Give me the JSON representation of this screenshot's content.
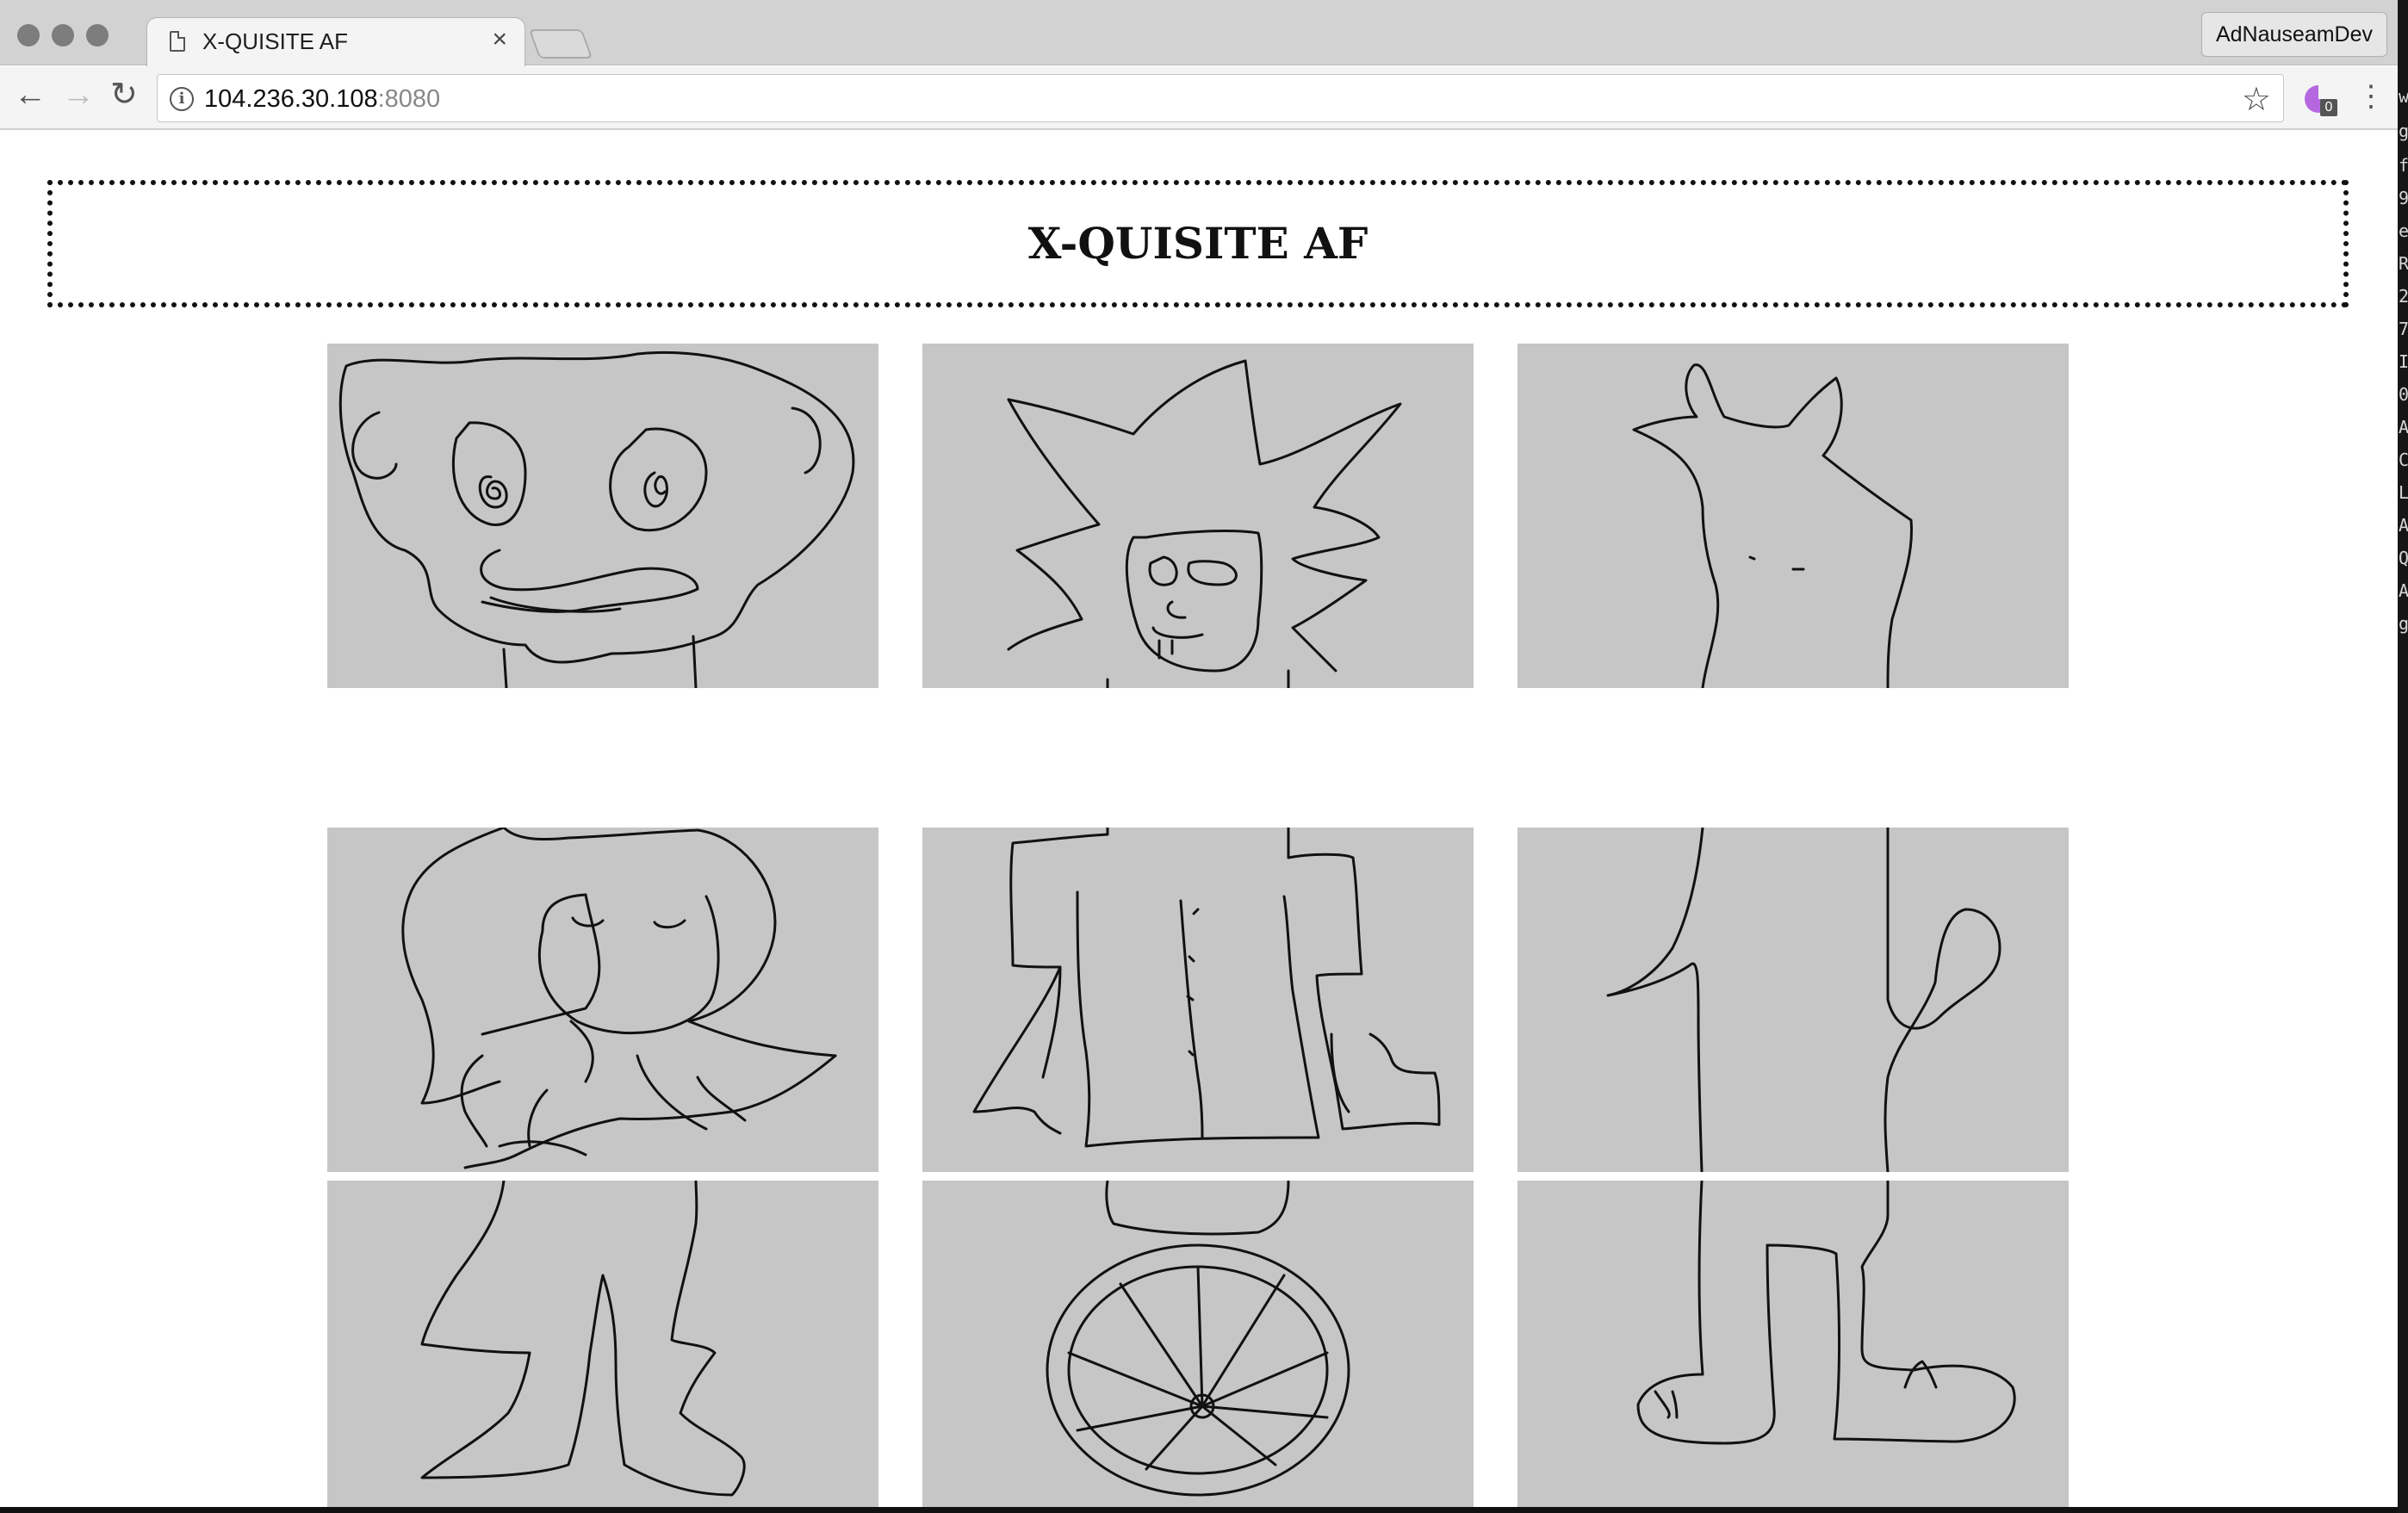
{
  "browser": {
    "tab_title": "X-QUISITE AF",
    "tab_close": "×",
    "profile_name": "AdNauseamDev",
    "url_host": "104.236.30.108",
    "url_port": ":8080",
    "extension_badge": "0"
  },
  "page": {
    "title": "X-QUISITE AF"
  },
  "drawings": {
    "columns": [
      {
        "head": "drawing",
        "torso": "drawing",
        "legs": "drawing"
      },
      {
        "head": "drawing",
        "torso": "drawing",
        "legs": "drawing"
      },
      {
        "head": "drawing",
        "torso": "drawing",
        "legs": "drawing"
      }
    ]
  },
  "terminal_chars": [
    "w",
    "g",
    "f",
    "9",
    "e",
    "R",
    "2",
    "7",
    "I",
    "0",
    "A",
    "C",
    "L",
    "A",
    "Q",
    "A",
    "g"
  ]
}
